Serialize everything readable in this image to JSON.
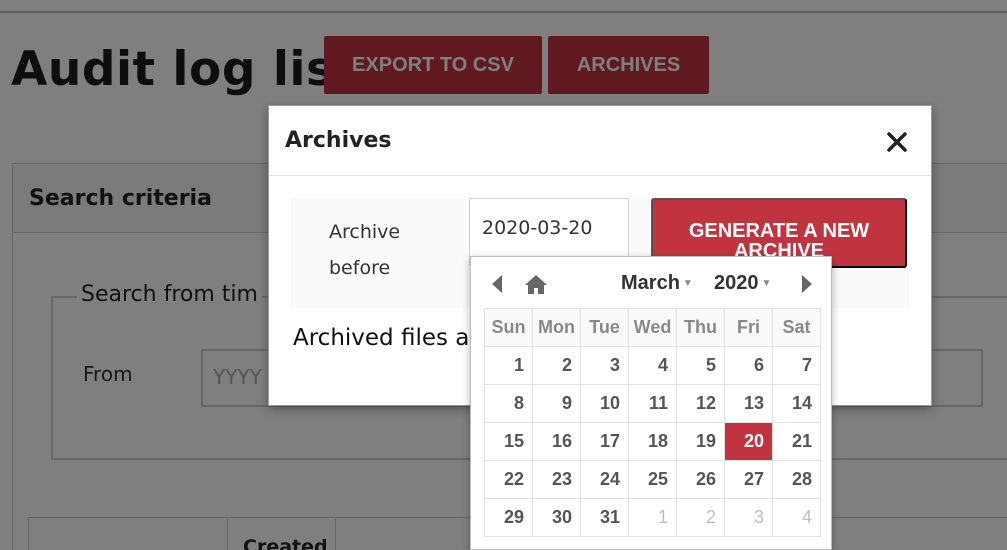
{
  "page": {
    "title": "Audit log list",
    "export_label": "EXPORT TO CSV",
    "archives_label": "ARCHIVES"
  },
  "search": {
    "header": "Search criteria",
    "legend": "Search from tim",
    "from_label": "From",
    "from_placeholder": "YYYY"
  },
  "table": {
    "created_header": "Created"
  },
  "modal": {
    "title": "Archives",
    "archive_label": "Archive before",
    "date_value": "2020-03-20",
    "generate_label": "GENERATE A NEW ARCHIVE",
    "archived_files_text": "Archived files a"
  },
  "datepicker": {
    "month": "March",
    "year": "2020",
    "weekdays": [
      "Sun",
      "Mon",
      "Tue",
      "Wed",
      "Thu",
      "Fri",
      "Sat"
    ],
    "weeks": [
      [
        {
          "d": "1"
        },
        {
          "d": "2"
        },
        {
          "d": "3"
        },
        {
          "d": "4"
        },
        {
          "d": "5"
        },
        {
          "d": "6"
        },
        {
          "d": "7"
        }
      ],
      [
        {
          "d": "8"
        },
        {
          "d": "9"
        },
        {
          "d": "10"
        },
        {
          "d": "11"
        },
        {
          "d": "12"
        },
        {
          "d": "13"
        },
        {
          "d": "14"
        }
      ],
      [
        {
          "d": "15"
        },
        {
          "d": "16"
        },
        {
          "d": "17"
        },
        {
          "d": "18"
        },
        {
          "d": "19"
        },
        {
          "d": "20",
          "selected": true
        },
        {
          "d": "21"
        }
      ],
      [
        {
          "d": "22"
        },
        {
          "d": "23"
        },
        {
          "d": "24"
        },
        {
          "d": "25"
        },
        {
          "d": "26"
        },
        {
          "d": "27"
        },
        {
          "d": "28"
        }
      ],
      [
        {
          "d": "29"
        },
        {
          "d": "30"
        },
        {
          "d": "31"
        },
        {
          "d": "1",
          "other": true
        },
        {
          "d": "2",
          "other": true
        },
        {
          "d": "3",
          "other": true
        },
        {
          "d": "4",
          "other": true
        }
      ]
    ]
  },
  "colors": {
    "accent": "#c0333f",
    "overlay": "rgba(0,0,0,0.5)"
  },
  "icons": {
    "close": "close-icon",
    "prev": "chevron-left-icon",
    "next": "chevron-right-icon",
    "home": "home-icon",
    "caret": "caret-down-icon"
  }
}
